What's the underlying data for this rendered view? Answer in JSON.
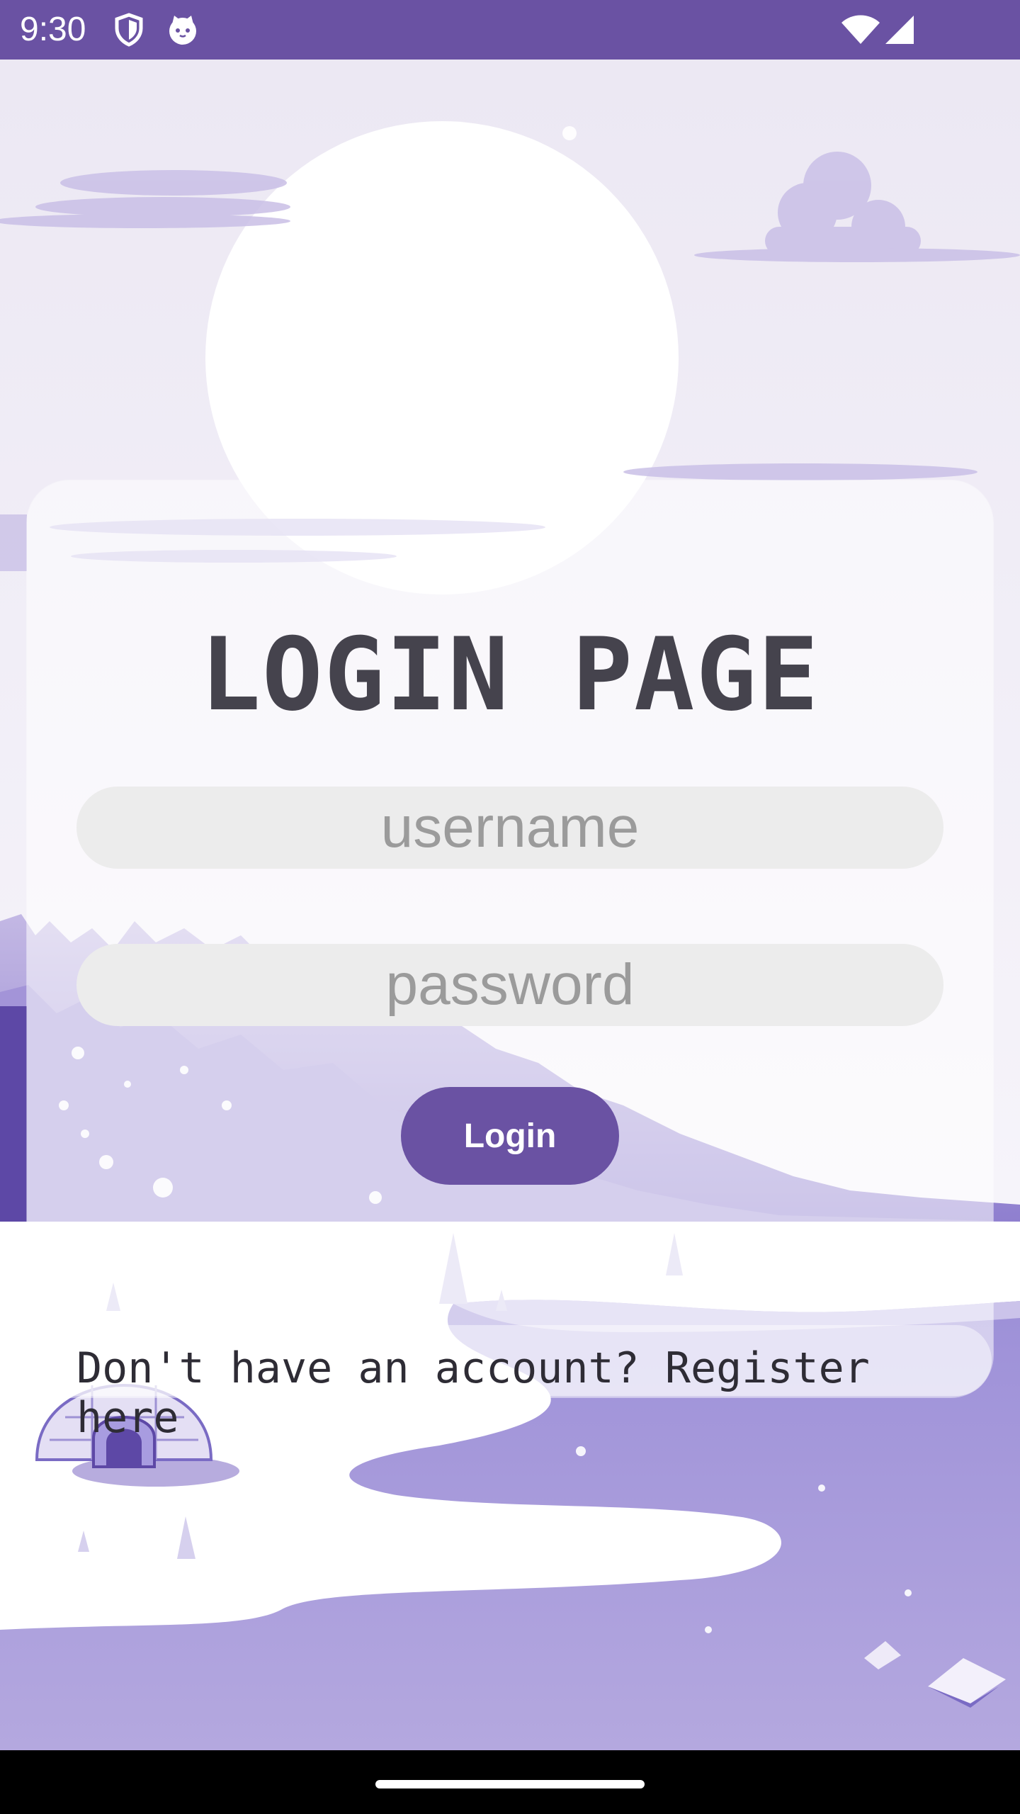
{
  "status_bar": {
    "time": "9:30",
    "left_icons": [
      "shield-icon",
      "cat-face-icon"
    ],
    "right_icons": [
      "wifi-icon",
      "cellular-signal-icon"
    ],
    "color": "#6a52a3"
  },
  "login": {
    "title": "LOGIN PAGE",
    "username_placeholder": "username",
    "password_placeholder": "password",
    "button_label": "Login",
    "register_text": "Don't have an account? Register here"
  },
  "colors": {
    "accent": "#6a52a3",
    "field_bg": "#ececec",
    "title_text": "#45434d"
  },
  "background": {
    "scene_icons": [
      "moon-icon",
      "cloud-icon",
      "forest-icon",
      "igloo-icon",
      "ice-floe-icon"
    ]
  }
}
